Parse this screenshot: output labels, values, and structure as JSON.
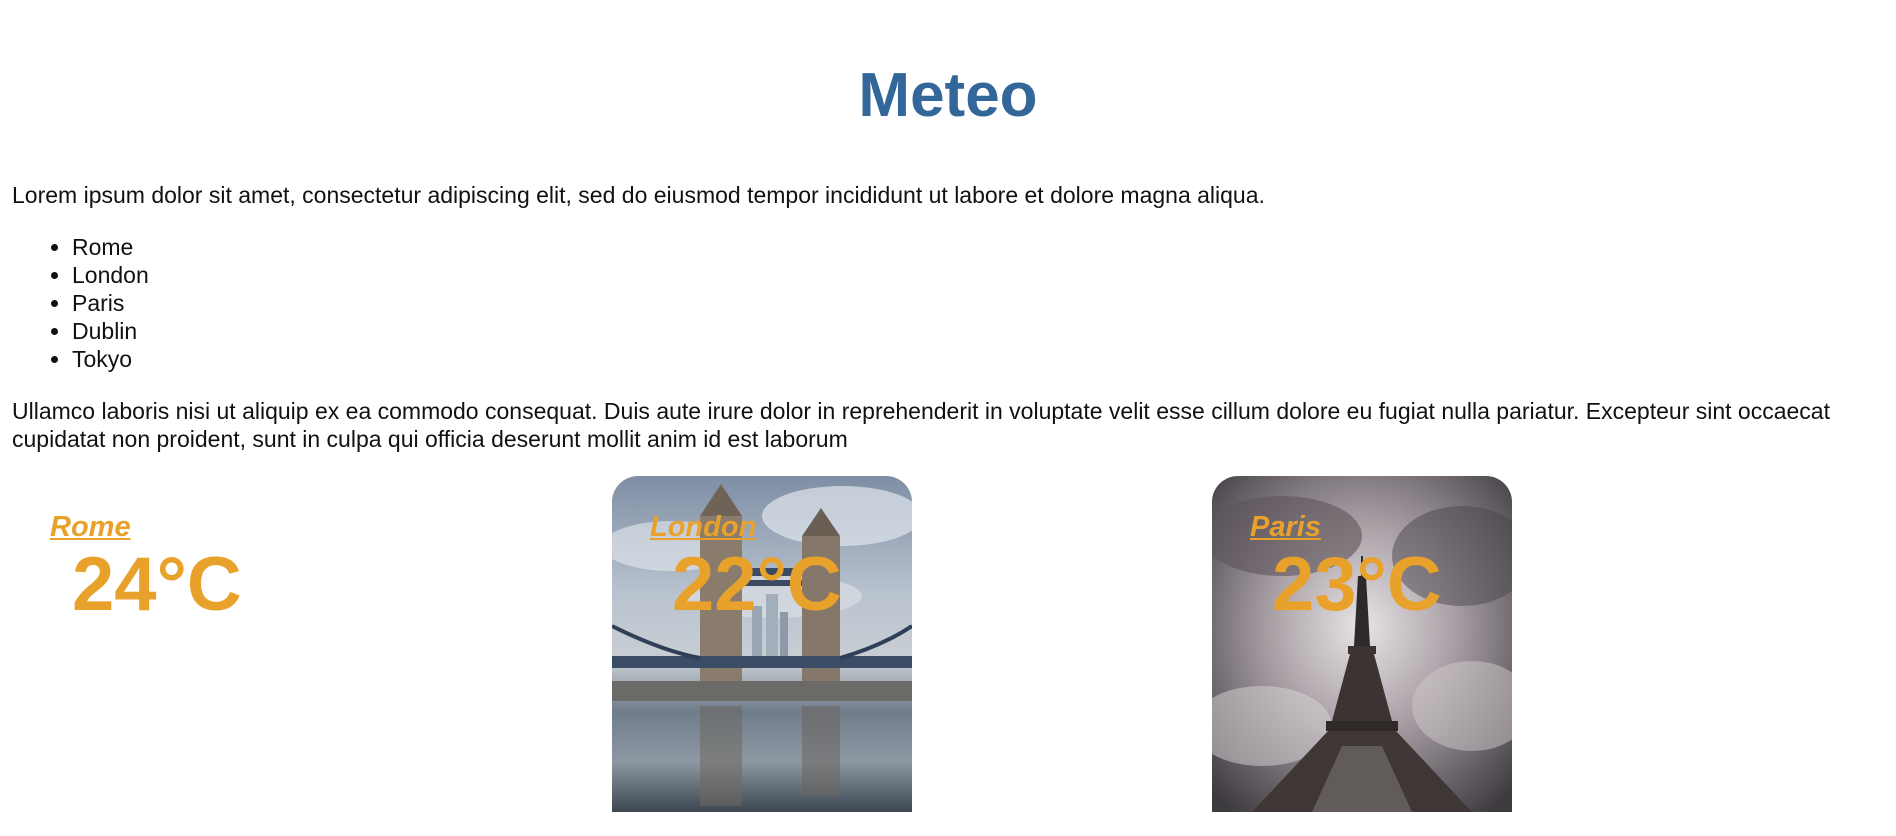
{
  "page": {
    "title": "Meteo",
    "intro": "Lorem ipsum dolor sit amet, consectetur adipiscing elit, sed do eiusmod tempor incididunt ut labore et dolore magna aliqua.",
    "cities": [
      "Rome",
      "London",
      "Paris",
      "Dublin",
      "Tokyo"
    ],
    "outro": "Ullamco laboris nisi ut aliquip ex ea commodo consequat. Duis aute irure dolor in reprehenderit in voluptate velit esse cillum dolore eu fugiat nulla pariatur. Excepteur sint occaecat cupidatat non proident, sunt in culpa qui officia deserunt mollit anim id est laborum"
  },
  "cards": [
    {
      "city": "Rome",
      "temp": "24°C",
      "image": "none"
    },
    {
      "city": "London",
      "temp": "22°C",
      "image": "tower-bridge-photo"
    },
    {
      "city": "Paris",
      "temp": "23°C",
      "image": "eiffel-tower-photo"
    }
  ],
  "colors": {
    "title": "#336699",
    "accent": "#e8a22b",
    "text": "#111111"
  }
}
